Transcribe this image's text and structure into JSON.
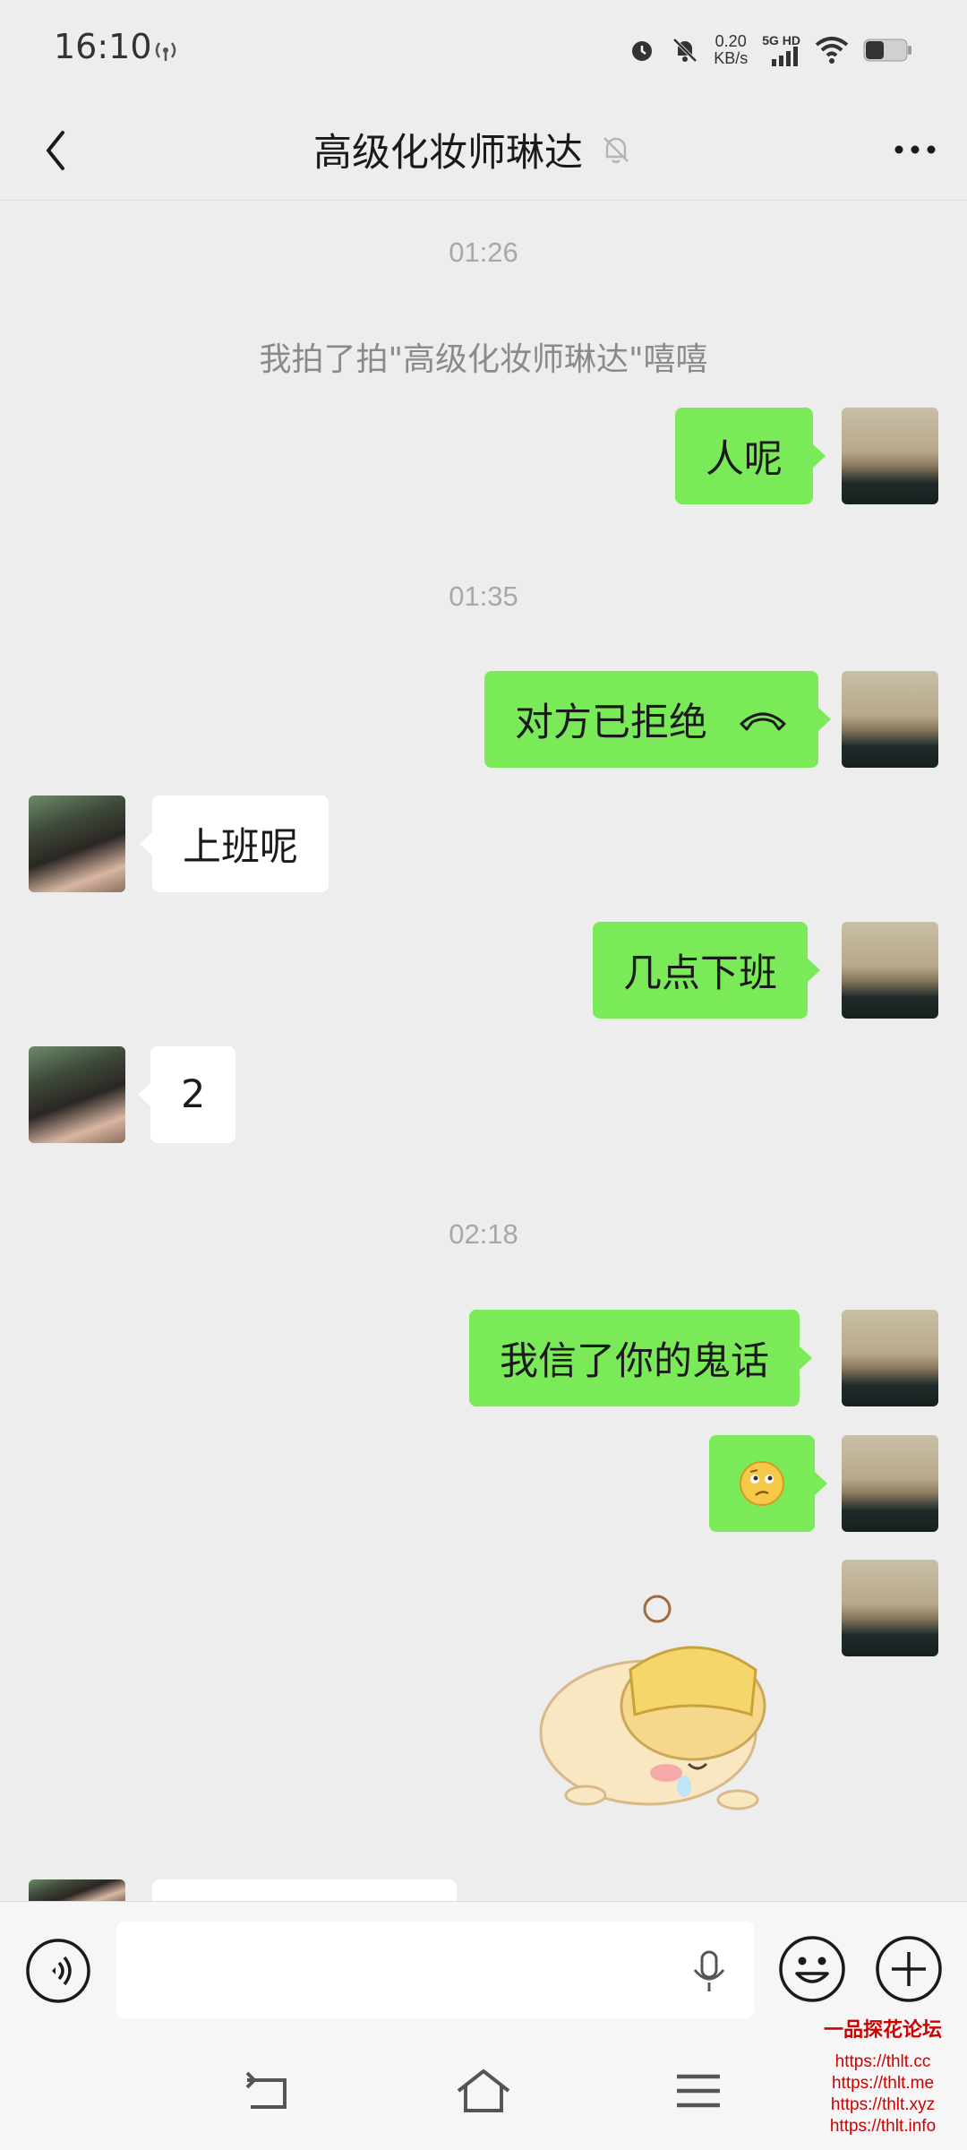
{
  "status_bar": {
    "time": "16:10",
    "speed_value": "0.20",
    "speed_unit": "KB/s",
    "network": "5G HD",
    "icons": [
      "nfc-icon",
      "alarm-icon",
      "mute-icon",
      "signal-icon",
      "wifi-icon",
      "battery-icon"
    ]
  },
  "header": {
    "title": "高级化妆师琳达",
    "back_icon": "chevron-left-icon",
    "mute_icon": "bell-off-icon",
    "more_icon": "more-dots-icon"
  },
  "chat": {
    "time_1": "01:26",
    "system_1": "我拍了拍\"高级化妆师琳达\"嘻嘻",
    "msg_1": "人呢",
    "time_2": "01:35",
    "msg_2": "对方已拒绝",
    "msg_3": "上班呢",
    "msg_4": "几点下班",
    "msg_5": "2",
    "time_3": "02:18",
    "msg_6": "我信了你的鬼话",
    "msg_7_icon": "confused-face-emoji",
    "msg_8_icon": "hamster-sticker"
  },
  "input_bar": {
    "voice_icon": "voice-mode-icon",
    "mic_icon": "microphone-icon",
    "emoji_icon": "smiley-icon",
    "plus_icon": "plus-icon"
  },
  "watermark": {
    "title": "一品探花论坛",
    "links": [
      "https://thlt.cc",
      "https://thlt.me",
      "https://thlt.xyz",
      "https://thlt.info"
    ]
  },
  "colors": {
    "background": "#ededed",
    "my_bubble": "#7aea59",
    "their_bubble": "#ffffff",
    "watermark": "#d00000"
  }
}
